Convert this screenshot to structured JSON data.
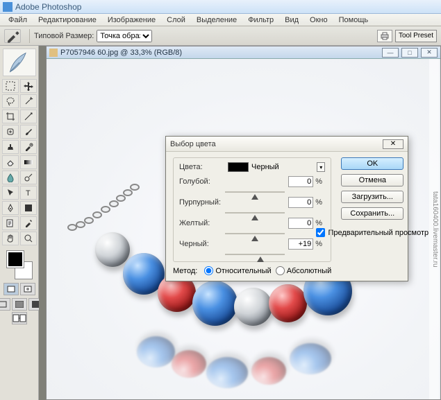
{
  "app": {
    "title": "Adobe Photoshop"
  },
  "menu": {
    "file": "Файл",
    "edit": "Редактирование",
    "image": "Изображение",
    "layer": "Слой",
    "select": "Выделение",
    "filter": "Фильтр",
    "view": "Вид",
    "window": "Окно",
    "help": "Помощь"
  },
  "options": {
    "label": "Типовой Размер:",
    "selected": "Точка образца",
    "tool_preset": "Tool Preset"
  },
  "document": {
    "title": "P7057946 60.jpg @ 33,3% (RGB/8)"
  },
  "dialog": {
    "title": "Выбор цвета",
    "colors_label": "Цвета:",
    "color_name": "Черный",
    "sliders": {
      "cyan": {
        "label": "Голубой:",
        "value": "0",
        "pos": 50
      },
      "magenta": {
        "label": "Пурпурный:",
        "value": "0",
        "pos": 50
      },
      "yellow": {
        "label": "Желтый:",
        "value": "0",
        "pos": 50
      },
      "black": {
        "label": "Черный:",
        "value": "+19",
        "pos": 59
      }
    },
    "percent": "%",
    "method": {
      "label": "Метод:",
      "relative": "Относительный",
      "absolute": "Абсолютный"
    },
    "buttons": {
      "ok": "OK",
      "cancel": "Отмена",
      "load": "Загрузить...",
      "save": "Сохранить..."
    },
    "preview": "Предварительный просмотр"
  },
  "watermark": "tata160400.livemaster.ru"
}
